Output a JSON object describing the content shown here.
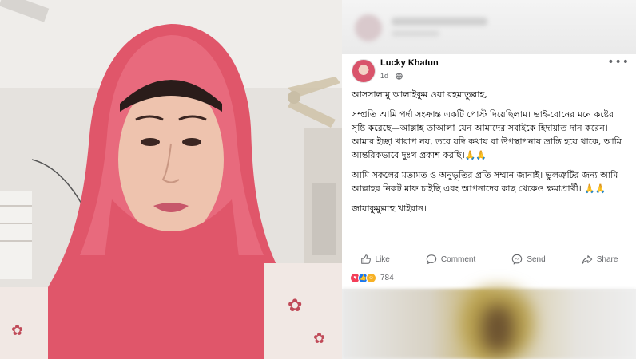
{
  "post": {
    "author": "Lucky Khatun",
    "time": "1d",
    "dot": "·",
    "more_label": "•••",
    "paragraphs": [
      "আসসালামু আলাইকুম ওয়া রহমাতুল্লাহ,",
      "সম্প্রতি আমি পর্দা সংক্রান্ত একটি পোস্ট দিয়েছিলাম। ভাই-বোনের মনে কষ্টের সৃষ্টি করেছে—আল্লাহ তাআলা যেন আমাদের সবাইকে হিদায়াত দান করেন। আমার ইচ্ছা খারাপ নয়, তবে যদি কথায় বা উপস্থাপনায় ভ্রান্তি হয়ে থাকে, আমি আন্তরিকভাবে দুঃখ প্রকাশ করছি।🙏🙏",
      "আমি সকলের মতামত ও অনুভূতির প্রতি সম্মান জানাই। ভুলত্রুটির জন্য আমি আল্লাহর নিকট মাফ চাইছি এবং আপনাদের কাছ থেকেও ক্ষমাপ্রার্থী। 🙏🙏",
      "জাযাকুমুল্লাহু খাইরান।"
    ]
  },
  "actions": {
    "like": "Like",
    "comment": "Comment",
    "send": "Send",
    "share": "Share"
  },
  "reactions": {
    "count": "784"
  },
  "icons": {
    "globe": "globe-icon",
    "like": "thumbs-up-icon",
    "comment": "comment-bubble-icon",
    "send": "messenger-icon",
    "share": "share-arrow-icon"
  },
  "colors": {
    "hijab": "#e0566a",
    "like_blue": "#1877f2",
    "love_red": "#f33e58",
    "haha_yellow": "#f7b125"
  }
}
